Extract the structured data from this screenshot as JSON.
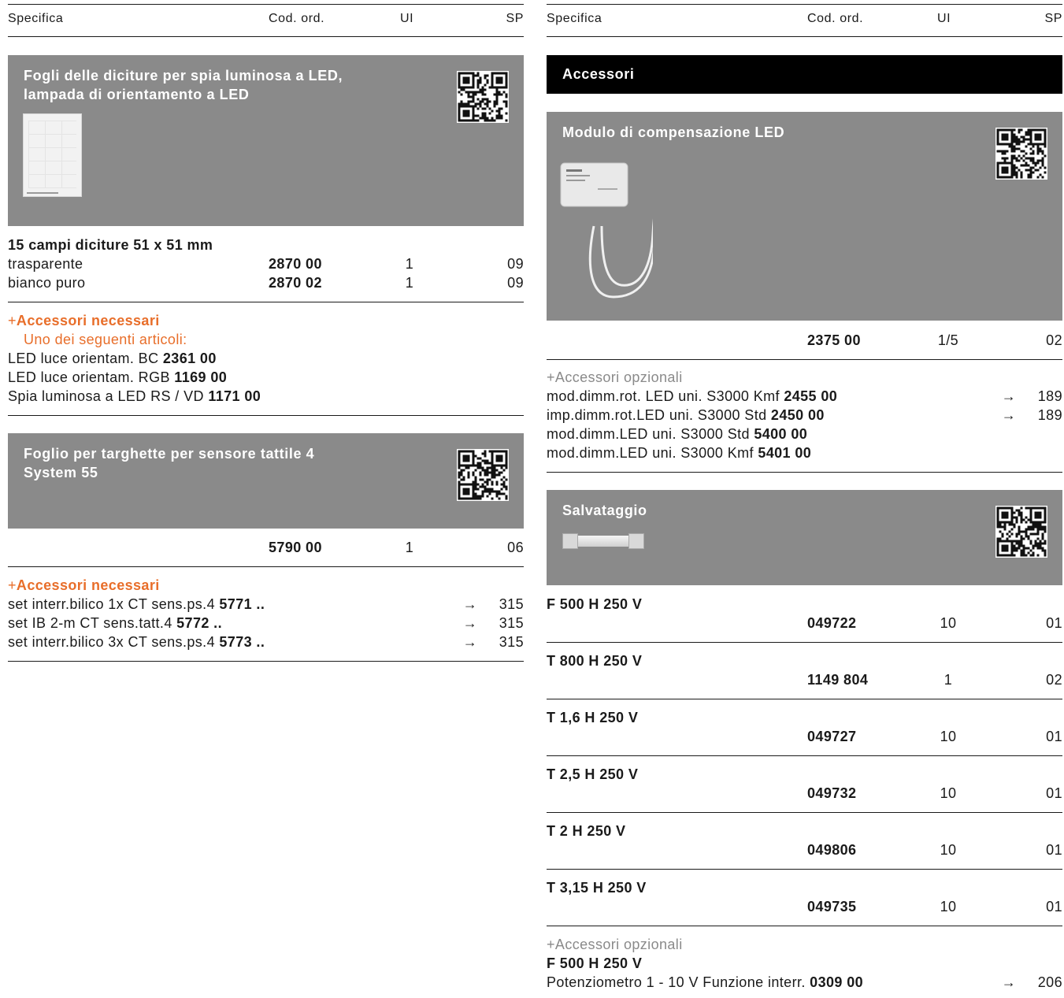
{
  "header": {
    "specifica": "Specifica",
    "cod": "Cod. ord.",
    "ui": "UI",
    "sp": "SP"
  },
  "left": {
    "card1": {
      "title1": "Fogli delle diciture per spia luminosa a LED,",
      "title2": "lampada di orientamento a LED",
      "spec_title": "15 campi diciture 51 x 51 mm",
      "rows": [
        {
          "label": "trasparente",
          "code": "2870 00",
          "ui": "1",
          "sp": "09"
        },
        {
          "label": "bianco puro",
          "code": "2870 02",
          "ui": "1",
          "sp": "09"
        }
      ],
      "acc_title": "Accessori necessari",
      "acc_sub": "Uno dei seguenti articoli:",
      "acc": [
        {
          "text": "LED luce orientam. BC ",
          "code": "2361 00"
        },
        {
          "text": "LED luce orientam. RGB ",
          "code": "1169 00"
        },
        {
          "text": "Spia luminosa a LED RS / VD ",
          "code": "1171 00"
        }
      ]
    },
    "card2": {
      "title1": "Foglio per targhette per sensore tattile 4",
      "title2": "System 55",
      "row": {
        "code": "5790 00",
        "ui": "1",
        "sp": "06"
      },
      "acc_title": "Accessori necessari",
      "acc": [
        {
          "text": "set interr.bilico 1x CT sens.ps.4 ",
          "code": "5771 ..",
          "arrow": "→",
          "page": "315"
        },
        {
          "text": "set IB 2-m CT sens.tatt.4 ",
          "code": "5772 ..",
          "arrow": "→",
          "page": "315"
        },
        {
          "text": "set interr.bilico 3x CT sens.ps.4 ",
          "code": "5773 ..",
          "arrow": "→",
          "page": "315"
        }
      ]
    }
  },
  "right": {
    "section": "Accessori",
    "card1": {
      "title": "Modulo di compensazione LED",
      "row": {
        "code": "2375 00",
        "ui": "1/5",
        "sp": "02"
      },
      "acc_title": "Accessori opzionali",
      "acc": [
        {
          "text": "mod.dimm.rot. LED uni. S3000 Kmf ",
          "code": "2455 00",
          "arrow": "→",
          "page": "189"
        },
        {
          "text": "imp.dimm.rot.LED uni. S3000 Std ",
          "code": "2450 00",
          "arrow": "→",
          "page": "189"
        },
        {
          "text": "mod.dimm.LED uni. S3000 Std ",
          "code": "5400 00",
          "arrow": "",
          "page": ""
        },
        {
          "text": "mod.dimm.LED uni. S3000 Kmf ",
          "code": "5401 00",
          "arrow": "",
          "page": ""
        }
      ]
    },
    "card2": {
      "title": "Salvataggio",
      "fuses": [
        {
          "label": "F 500 H 250 V",
          "code": "049722",
          "ui": "10",
          "sp": "01"
        },
        {
          "label": "T 800 H 250 V",
          "code": "1149 804",
          "ui": "1",
          "sp": "02"
        },
        {
          "label": "T 1,6 H 250 V",
          "code": "049727",
          "ui": "10",
          "sp": "01"
        },
        {
          "label": "T 2,5 H 250 V",
          "code": "049732",
          "ui": "10",
          "sp": "01"
        },
        {
          "label": "T 2 H 250 V",
          "code": "049806",
          "ui": "10",
          "sp": "01"
        },
        {
          "label": "T 3,15 H 250 V",
          "code": "049735",
          "ui": "10",
          "sp": "01"
        }
      ],
      "acc_title": "Accessori opzionali",
      "acc_spec": "F 500 H 250 V",
      "acc": {
        "text": "Potenziometro 1 - 10 V Funzione interr. ",
        "code": "0309 00",
        "arrow": "→",
        "page": "206"
      }
    }
  },
  "plus_glyph": "+",
  "colors": {
    "card_grey": "#8a8a8a",
    "accent_orange": "#e86e2a",
    "text": "#1a1a1a"
  }
}
